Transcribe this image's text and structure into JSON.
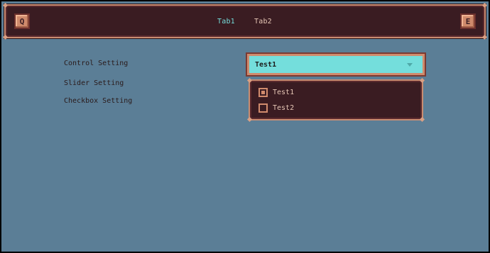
{
  "topbar": {
    "left_key": "Q",
    "right_key": "E",
    "tabs": [
      {
        "label": "Tab1",
        "active": true
      },
      {
        "label": "Tab2",
        "active": false
      }
    ]
  },
  "settings": {
    "labels": [
      "Control Setting",
      "Slider Setting",
      "Checkbox Setting"
    ]
  },
  "dropdown": {
    "selected": "Test1",
    "options": [
      {
        "label": "Test1",
        "checked": true
      },
      {
        "label": "Test2",
        "checked": false
      }
    ]
  },
  "colors": {
    "background": "#5b7e96",
    "panel": "#3a1c22",
    "accent": "#d08b6d",
    "highlight": "#74dedc",
    "active_tab": "#74dedc",
    "inactive_tab": "#e7c7b6"
  },
  "icons": [
    "keycap-q-icon",
    "keycap-e-icon",
    "chevron-down-icon",
    "checkbox-icon"
  ]
}
